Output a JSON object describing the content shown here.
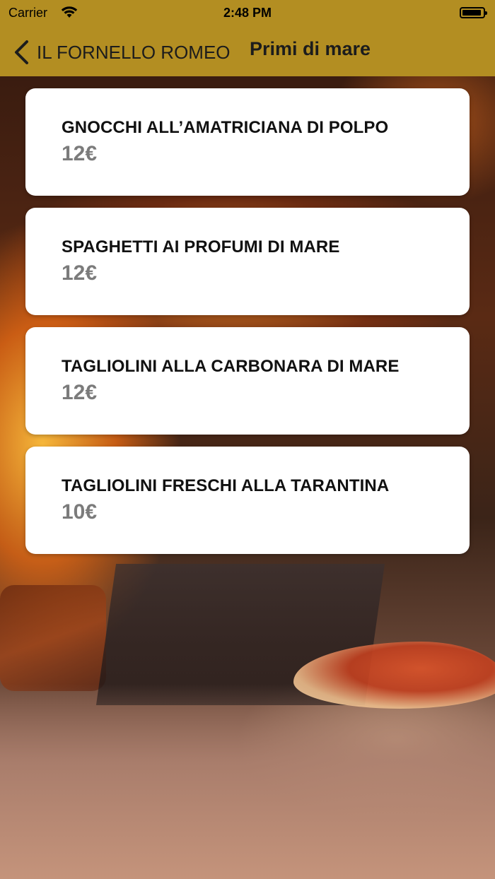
{
  "status_bar": {
    "carrier": "Carrier",
    "time": "2:48 PM"
  },
  "nav": {
    "back_label": "IL FORNELLO ROMEO",
    "title": "Primi di mare"
  },
  "colors": {
    "nav_background": "#b38e22",
    "card_background": "#ffffff",
    "price_text": "#7b7b7b"
  },
  "icons": [
    "wifi-icon",
    "battery-icon",
    "chevron-left-icon"
  ],
  "menu_items": [
    {
      "name": "GNOCCHI ALL’AMATRICIANA DI POLPO",
      "price": "12€"
    },
    {
      "name": "SPAGHETTI AI PROFUMI DI MARE",
      "price": "12€"
    },
    {
      "name": "TAGLIOLINI ALLA CARBONARA DI MARE",
      "price": "12€"
    },
    {
      "name": "TAGLIOLINI FRESCHI ALLA TARANTINA",
      "price": "10€"
    }
  ]
}
